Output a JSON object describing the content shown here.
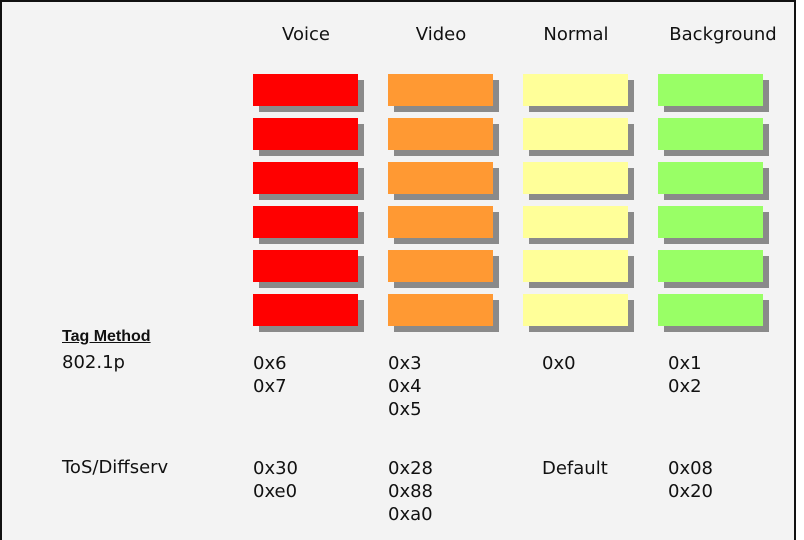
{
  "columns": [
    {
      "header": "Voice",
      "color": "#ff0000",
      "p8021": [
        "0x6",
        "0x7"
      ],
      "tos": [
        "0x30",
        "0xe0"
      ]
    },
    {
      "header": "Video",
      "color": "#ff9933",
      "p8021": [
        "0x3",
        "0x4",
        "0x5"
      ],
      "tos": [
        "0x28",
        "0x88",
        "0xa0"
      ]
    },
    {
      "header": "Normal",
      "color": "#ffff99",
      "p8021": [
        "0x0"
      ],
      "tos": [
        "Default"
      ]
    },
    {
      "header": "Background",
      "color": "#99ff66",
      "p8021": [
        "0x1",
        "0x2"
      ],
      "tos": [
        "0x08",
        "0x20"
      ]
    }
  ],
  "block_count": 6,
  "tag_method": "Tag Method",
  "row_labels": {
    "p8021": "802.1p",
    "tos": "ToS/Diffserv"
  }
}
